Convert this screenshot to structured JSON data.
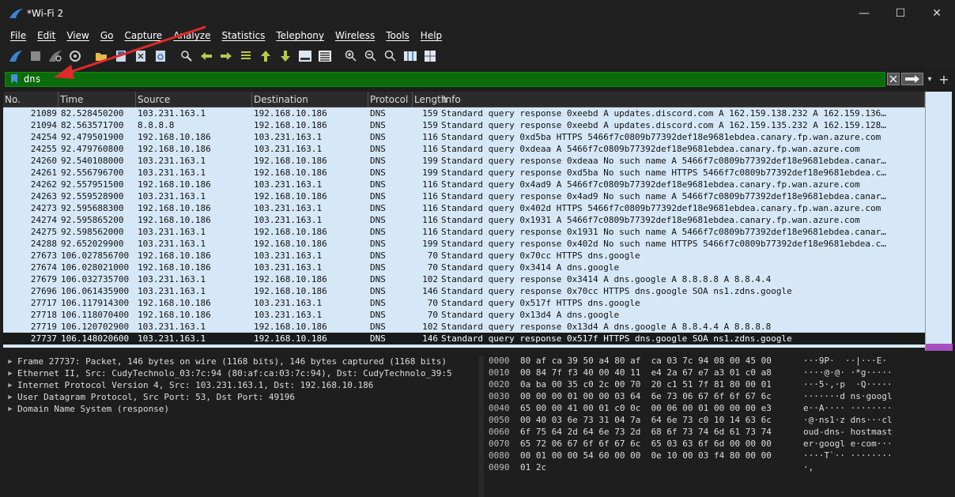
{
  "window": {
    "title": "*Wi-Fi 2",
    "minimize": "—",
    "maximize": "☐",
    "close": "✕"
  },
  "menu": [
    "File",
    "Edit",
    "View",
    "Go",
    "Capture",
    "Analyze",
    "Statistics",
    "Telephony",
    "Wireless",
    "Tools",
    "Help"
  ],
  "filter": {
    "value": "dns",
    "fill_color": "#0a6b0a"
  },
  "columns": {
    "no": "No.",
    "time": "Time",
    "source": "Source",
    "destination": "Destination",
    "protocol": "Protocol",
    "length": "Length",
    "info": "Info"
  },
  "packets": [
    {
      "no": "21089",
      "time": "82.528450200",
      "src": "103.231.163.1",
      "dst": "192.168.10.186",
      "proto": "DNS",
      "len": "159",
      "info": "Standard query response 0xeebd A updates.discord.com A 162.159.138.232 A 162.159.136…"
    },
    {
      "no": "21094",
      "time": "82.563571700",
      "src": "8.8.8.8",
      "dst": "192.168.10.186",
      "proto": "DNS",
      "len": "159",
      "info": "Standard query response 0xeebd A updates.discord.com A 162.159.135.232 A 162.159.128…"
    },
    {
      "no": "24254",
      "time": "92.479501900",
      "src": "192.168.10.186",
      "dst": "103.231.163.1",
      "proto": "DNS",
      "len": "116",
      "info": "Standard query 0xd5ba HTTPS 5466f7c0809b77392def18e9681ebdea.canary.fp.wan.azure.com"
    },
    {
      "no": "24255",
      "time": "92.479760800",
      "src": "192.168.10.186",
      "dst": "103.231.163.1",
      "proto": "DNS",
      "len": "116",
      "info": "Standard query 0xdeaa A 5466f7c0809b77392def18e9681ebdea.canary.fp.wan.azure.com"
    },
    {
      "no": "24260",
      "time": "92.540108000",
      "src": "103.231.163.1",
      "dst": "192.168.10.186",
      "proto": "DNS",
      "len": "199",
      "info": "Standard query response 0xdeaa No such name A 5466f7c0809b77392def18e9681ebdea.canar…"
    },
    {
      "no": "24261",
      "time": "92.556796700",
      "src": "103.231.163.1",
      "dst": "192.168.10.186",
      "proto": "DNS",
      "len": "199",
      "info": "Standard query response 0xd5ba No such name HTTPS 5466f7c0809b77392def18e9681ebdea.c…"
    },
    {
      "no": "24262",
      "time": "92.557951500",
      "src": "192.168.10.186",
      "dst": "103.231.163.1",
      "proto": "DNS",
      "len": "116",
      "info": "Standard query 0x4ad9 A 5466f7c0809b77392def18e9681ebdea.canary.fp.wan.azure.com"
    },
    {
      "no": "24263",
      "time": "92.559528900",
      "src": "103.231.163.1",
      "dst": "192.168.10.186",
      "proto": "DNS",
      "len": "116",
      "info": "Standard query response 0x4ad9 No such name A 5466f7c0809b77392def18e9681ebdea.canar…"
    },
    {
      "no": "24273",
      "time": "92.595688300",
      "src": "192.168.10.186",
      "dst": "103.231.163.1",
      "proto": "DNS",
      "len": "116",
      "info": "Standard query 0x402d HTTPS 5466f7c0809b77392def18e9681ebdea.canary.fp.wan.azure.com"
    },
    {
      "no": "24274",
      "time": "92.595865200",
      "src": "192.168.10.186",
      "dst": "103.231.163.1",
      "proto": "DNS",
      "len": "116",
      "info": "Standard query 0x1931 A 5466f7c0809b77392def18e9681ebdea.canary.fp.wan.azure.com"
    },
    {
      "no": "24275",
      "time": "92.598562000",
      "src": "103.231.163.1",
      "dst": "192.168.10.186",
      "proto": "DNS",
      "len": "116",
      "info": "Standard query response 0x1931 No such name A 5466f7c0809b77392def18e9681ebdea.canar…"
    },
    {
      "no": "24288",
      "time": "92.652029900",
      "src": "103.231.163.1",
      "dst": "192.168.10.186",
      "proto": "DNS",
      "len": "199",
      "info": "Standard query response 0x402d No such name HTTPS 5466f7c0809b77392def18e9681ebdea.c…"
    },
    {
      "no": "27673",
      "time": "106.027856700",
      "src": "192.168.10.186",
      "dst": "103.231.163.1",
      "proto": "DNS",
      "len": "70",
      "info": "Standard query 0x70cc HTTPS dns.google"
    },
    {
      "no": "27674",
      "time": "106.028021000",
      "src": "192.168.10.186",
      "dst": "103.231.163.1",
      "proto": "DNS",
      "len": "70",
      "info": "Standard query 0x3414 A dns.google"
    },
    {
      "no": "27679",
      "time": "106.032735700",
      "src": "103.231.163.1",
      "dst": "192.168.10.186",
      "proto": "DNS",
      "len": "102",
      "info": "Standard query response 0x3414 A dns.google A 8.8.8.8 A 8.8.4.4"
    },
    {
      "no": "27696",
      "time": "106.061435900",
      "src": "103.231.163.1",
      "dst": "192.168.10.186",
      "proto": "DNS",
      "len": "146",
      "info": "Standard query response 0x70cc HTTPS dns.google SOA ns1.zdns.google"
    },
    {
      "no": "27717",
      "time": "106.117914300",
      "src": "192.168.10.186",
      "dst": "103.231.163.1",
      "proto": "DNS",
      "len": "70",
      "info": "Standard query 0x517f HTTPS dns.google"
    },
    {
      "no": "27718",
      "time": "106.118070400",
      "src": "192.168.10.186",
      "dst": "103.231.163.1",
      "proto": "DNS",
      "len": "70",
      "info": "Standard query 0x13d4 A dns.google"
    },
    {
      "no": "27719",
      "time": "106.120702900",
      "src": "103.231.163.1",
      "dst": "192.168.10.186",
      "proto": "DNS",
      "len": "102",
      "info": "Standard query response 0x13d4 A dns.google A 8.8.4.4 A 8.8.8.8"
    },
    {
      "no": "27737",
      "time": "106.148020600",
      "src": "103.231.163.1",
      "dst": "192.168.10.186",
      "proto": "DNS",
      "len": "146",
      "info": "Standard query response 0x517f HTTPS dns.google SOA ns1.zdns.google"
    }
  ],
  "details": [
    "Frame 27737: Packet, 146 bytes on wire (1168 bits), 146 bytes captured (1168 bits)",
    "Ethernet II, Src: CudyTechnolo_03:7c:94 (80:af:ca:03:7c:94), Dst: CudyTechnolo_39:5",
    "Internet Protocol Version 4, Src: 103.231.163.1, Dst: 192.168.10.186",
    "User Datagram Protocol, Src Port: 53, Dst Port: 49196",
    "Domain Name System (response)"
  ],
  "hex": [
    {
      "off": "0000",
      "bytes": "80 af ca 39 50 a4 80 af  ca 03 7c 94 08 00 45 00",
      "ascii": "···9P·  ··|···E·"
    },
    {
      "off": "0010",
      "bytes": "00 84 7f f3 40 00 40 11  e4 2a 67 e7 a3 01 c0 a8",
      "ascii": "····@·@· ·*g·····"
    },
    {
      "off": "0020",
      "bytes": "0a ba 00 35 c0 2c 00 70  20 c1 51 7f 81 80 00 01",
      "ascii": "···5·,·p  ·Q·····"
    },
    {
      "off": "0030",
      "bytes": "00 00 00 01 00 00 03 64  6e 73 06 67 6f 6f 67 6c",
      "ascii": "·······d ns·googl"
    },
    {
      "off": "0040",
      "bytes": "65 00 00 41 00 01 c0 0c  00 06 00 01 00 00 00 e3",
      "ascii": "e··A···· ········"
    },
    {
      "off": "0050",
      "bytes": "00 40 03 6e 73 31 04 7a  64 6e 73 c0 10 14 63 6c",
      "ascii": "·@·ns1·z dns···cl"
    },
    {
      "off": "0060",
      "bytes": "6f 75 64 2d 64 6e 73 2d  68 6f 73 74 6d 61 73 74",
      "ascii": "oud-dns- hostmast"
    },
    {
      "off": "0070",
      "bytes": "65 72 06 67 6f 6f 67 6c  65 03 63 6f 6d 00 00 00",
      "ascii": "er·googl e·com···"
    },
    {
      "off": "0080",
      "bytes": "00 01 00 00 54 60 00 00  0e 10 00 03 f4 80 00 00",
      "ascii": "····T`·· ········"
    },
    {
      "off": "0090",
      "bytes": "01 2c",
      "ascii": "·,"
    }
  ]
}
